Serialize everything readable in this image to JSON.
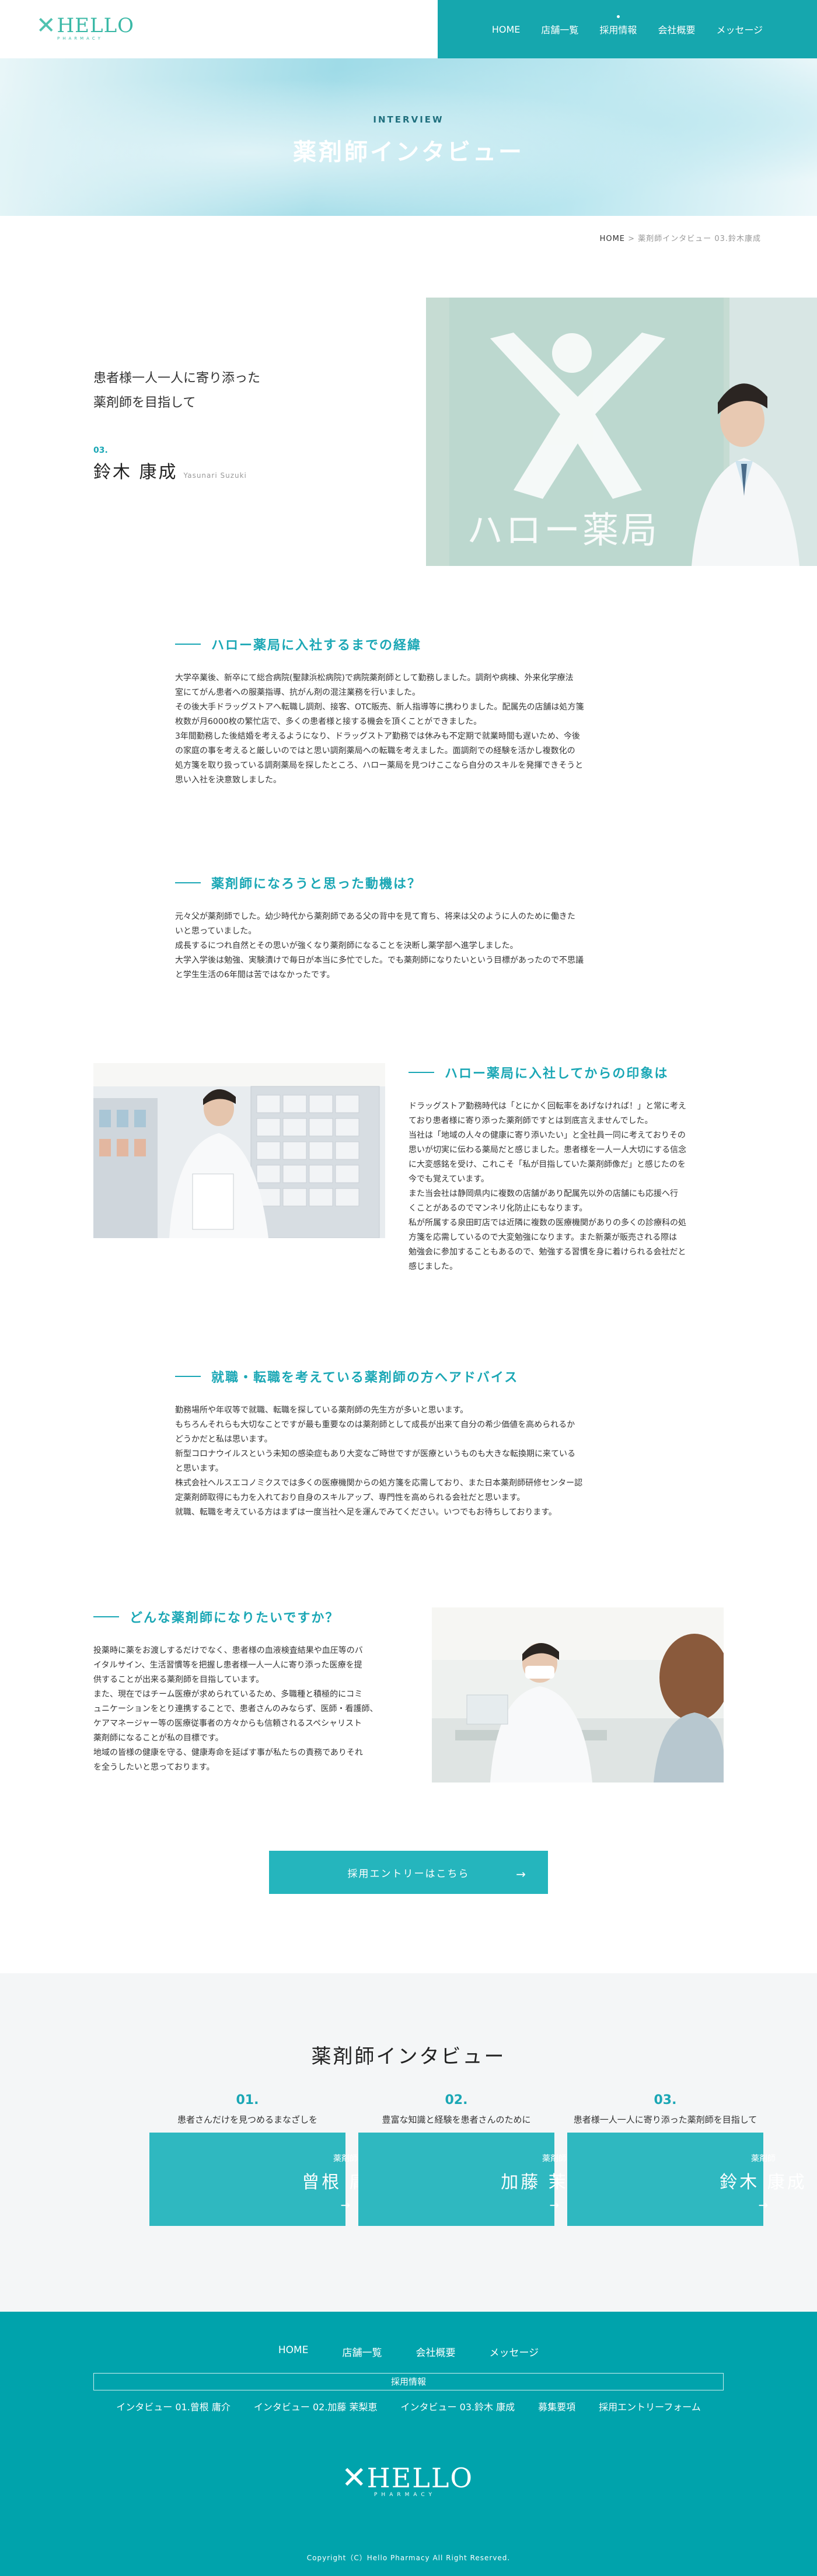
{
  "header": {
    "logo": {
      "text": "HELLO",
      "sub": "PHARMACY"
    },
    "nav": [
      "HOME",
      "店舗一覧",
      "採用情報",
      "会社概要",
      "メッセージ"
    ],
    "brand_color": "#16a7ae"
  },
  "hero": {
    "en": "INTERVIEW",
    "ja": "薬剤師インタビュー"
  },
  "breadcrumb": {
    "home": "HOME",
    "sep": " > ",
    "current": "薬剤師インタビュー 03.鈴木康成"
  },
  "profile": {
    "catch_1": "患者様一人一人に寄り添った",
    "catch_2": "薬剤師を目指して",
    "number": "03.",
    "name": "鈴木 康成",
    "roman": "Yasunari Suzuki",
    "photo_sign": "ハロー薬局"
  },
  "sections": [
    {
      "title": "ハロー薬局に入社するまでの経緯",
      "paragraphs": [
        "大学卒業後、新卒にて総合病院(聖隷浜松病院)で病院薬剤師として勤務しました。調剤や病棟、外来化学療法",
        "室にてがん患者への服薬指導、抗がん剤の混注業務を行いました。",
        "その後大手ドラッグストアへ転職し調剤、接客、OTC販売、新人指導等に携わりました。配属先の店舗は処方箋",
        "枚数が月6000枚の繁忙店で、多くの患者様と接する機会を頂くことができました。",
        "3年間勤務した後結婚を考えるようになり、ドラッグストア勤務では休みも不定期で就業時間も遅いため、今後",
        "の家庭の事を考えると厳しいのではと思い調剤薬局への転職を考えました。面調剤での経験を活かし複数化の",
        "処方箋を取り扱っている調剤薬局を探したところ、ハロー薬局を見つけここなら自分のスキルを発揮できそうと",
        "思い入社を決意致しました。"
      ]
    },
    {
      "title": "薬剤師になろうと思った動機は？",
      "paragraphs": [
        "元々父が薬剤師でした。幼少時代から薬剤師である父の背中を見て育ち、将来は父のように人のために働きた",
        "いと思っていました。",
        "成長するにつれ自然とその思いが強くなり薬剤師になることを決断し薬学部へ進学しました。",
        "大学入学後は勉強、実験漬けで毎日が本当に多忙でした。でも薬剤師になりたいという目標があったので不思議",
        "と学生生活の6年間は苦ではなかったです。"
      ]
    },
    {
      "title": "ハロー薬局に入社してからの印象は",
      "paragraphs": [
        "ドラッグストア勤務時代は「とにかく回転率をあげなければ！」と常に考え",
        "ており患者様に寄り添った薬剤師ですとは到底言えませんでした。",
        "当社は「地域の人々の健康に寄り添いたい」と全社員一同に考えておりその",
        "思いが切実に伝わる薬局だと感じました。患者様を一人一人大切にする信念",
        "に大変感銘を受け、これこそ「私が目指していた薬剤師像だ」と感じたのを",
        "今でも覚えています。",
        "また当会社は静岡県内に複数の店舗があり配属先以外の店舗にも応援へ行",
        "くことがあるのでマンネリ化防止にもなります。",
        "私が所属する泉田町店では近隣に複数の医療機関がありの多くの診療科の処",
        "方箋を応需しているので大変勉強になります。また新薬が販売される際は",
        "勉強会に参加することもあるので、勉強する習慣を身に着けられる会社だと",
        "感じました。"
      ]
    },
    {
      "title": "就職・転職を考えている薬剤師の方へアドバイス",
      "paragraphs": [
        "勤務場所や年収等で就職、転職を探している薬剤師の先生方が多いと思います。",
        "もちろんそれらも大切なことですが最も重要なのは薬剤師として成長が出来て自分の希少価値を高められるか",
        "どうかだと私は思います。",
        "新型コロナウイルスという未知の感染症もあり大変なご時世ですが医療というものも大きな転換期に来ている",
        "と思います。",
        "株式会社ヘルスエコノミクスでは多くの医療機関からの処方箋を応需しており、また日本薬剤師研修センター認",
        "定薬剤師取得にも力を入れており自身のスキルアップ、専門性を高められる会社だと思います。",
        "就職、転職を考えている方はまずは一度当社へ足を運んでみてください。いつでもお待ちしております。"
      ]
    },
    {
      "title": "どんな薬剤師になりたいですか？",
      "paragraphs": [
        "投薬時に薬をお渡しするだけでなく、患者様の血液検査結果や血圧等のバ",
        "イタルサイン、生活習慣等を把握し患者様一人一人に寄り添った医療を提",
        "供することが出来る薬剤師を目指しています。",
        "また、現在ではチーム医療が求められているため、多職種と積極的にコミ",
        "ュニケーションをとり連携することで、患者さんのみならず、医師・看護師、",
        "ケアマネージャー等の医療従事者の方々からも信頼されるスペシャリスト",
        "薬剤師になることが私の目標です。",
        "地域の皆様の健康を守る、健康寿命を延ばす事が私たちの責務でありそれ",
        "を全うしたいと思っております。"
      ]
    }
  ],
  "entry": {
    "label": "採用エントリーはこちら",
    "arrow": "→"
  },
  "related": {
    "title": "薬剤師インタビュー",
    "cards": [
      {
        "num": "01.",
        "catch": "患者さんだけを見つめるまなざしを",
        "role": "薬剤師",
        "name": "曾根 庸介",
        "arrow": "→"
      },
      {
        "num": "02.",
        "catch": "豊富な知識と経験を患者さんのために",
        "role": "薬剤師",
        "name": "加藤 茉梨恵",
        "arrow": "→"
      },
      {
        "num": "03.",
        "catch": "患者様一人一人に寄り添った薬剤師を目指して",
        "role": "薬剤師",
        "name": "鈴木 康成",
        "arrow": "→"
      }
    ]
  },
  "footer": {
    "nav": [
      "HOME",
      "店舗一覧",
      "会社概要",
      "メッセージ"
    ],
    "recruit_label": "採用情報",
    "recruit_links": [
      "インタビュー 01.曾根 庸介",
      "インタビュー 02.加藤 茉梨恵",
      "インタビュー 03.鈴木 康成",
      "募集要項",
      "採用エントリーフォーム"
    ],
    "logo": {
      "text": "HELLO",
      "sub": "PHARMACY"
    },
    "copyright": "Copyright（C）Hello Pharmacy All Right Reserved.",
    "bg_color": "#00a3ac"
  }
}
